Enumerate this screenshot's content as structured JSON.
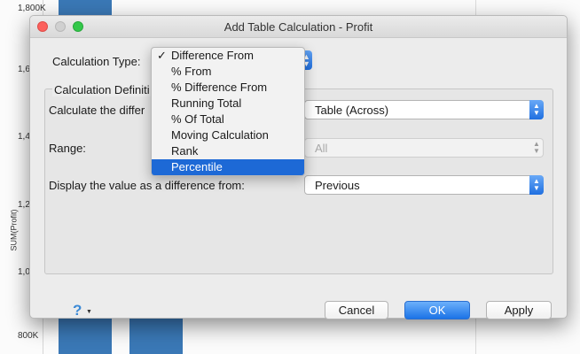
{
  "background": {
    "y_ticks": [
      "1,800K",
      "1,60",
      "1,40",
      "1,20",
      "1,00",
      "800K"
    ],
    "y_axis_title": "SUM(Profit)",
    "bar_color": "#3a78b6"
  },
  "dialog": {
    "title": "Add Table Calculation - Profit",
    "calculation_type_label": "Calculation Type:",
    "group_title": "Calculation Definiti",
    "calculate_label": "Calculate the differ",
    "calculate_value": "Table (Across)",
    "range_label": "Range:",
    "range_value": "All",
    "display_label": "Display the value as a difference from:",
    "display_value": "Previous",
    "menu": {
      "check_mark": "✓",
      "items": [
        "Difference From",
        "% From",
        "% Difference From",
        "Running Total",
        "% Of Total",
        "Moving Calculation",
        "Rank",
        "Percentile"
      ]
    },
    "buttons": {
      "cancel": "Cancel",
      "ok": "OK",
      "apply": "Apply"
    },
    "help_glyph": "?",
    "accent_color": "#1d69d6"
  }
}
